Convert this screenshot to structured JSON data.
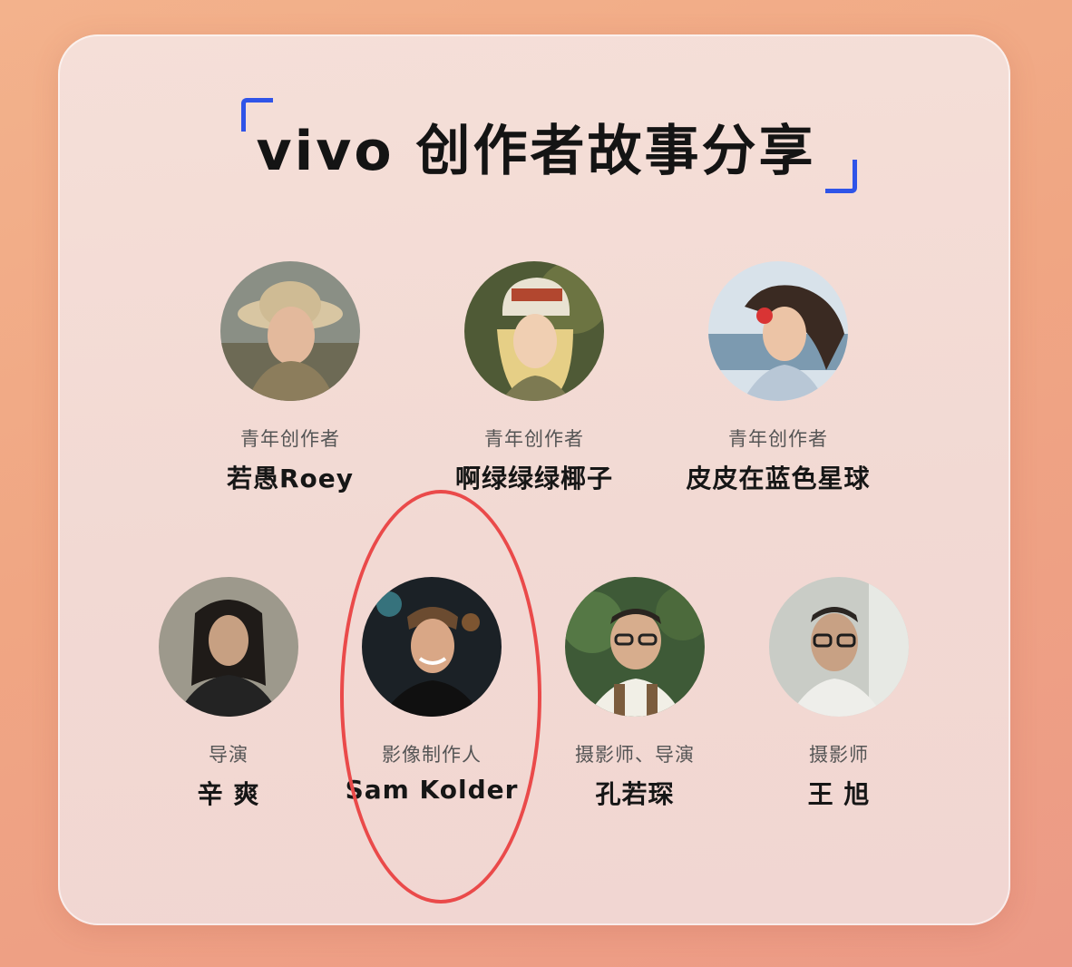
{
  "header": {
    "title": "vivo 创作者故事分享"
  },
  "creators": [
    {
      "role": "青年创作者",
      "name": "若愚Roey"
    },
    {
      "role": "青年创作者",
      "name": "啊绿绿绿椰子"
    },
    {
      "role": "青年创作者",
      "name": "皮皮在蓝色星球"
    },
    {
      "role": "导演",
      "name": "辛  爽"
    },
    {
      "role": "影像制作人",
      "name": "Sam Kolder"
    },
    {
      "role": "摄影师、导演",
      "name": "孔若琛"
    },
    {
      "role": "摄影师",
      "name": "王  旭"
    }
  ],
  "colors": {
    "accent": "#2f54e8",
    "highlight": "#ea4a4a",
    "card": "#f4ddd6"
  }
}
